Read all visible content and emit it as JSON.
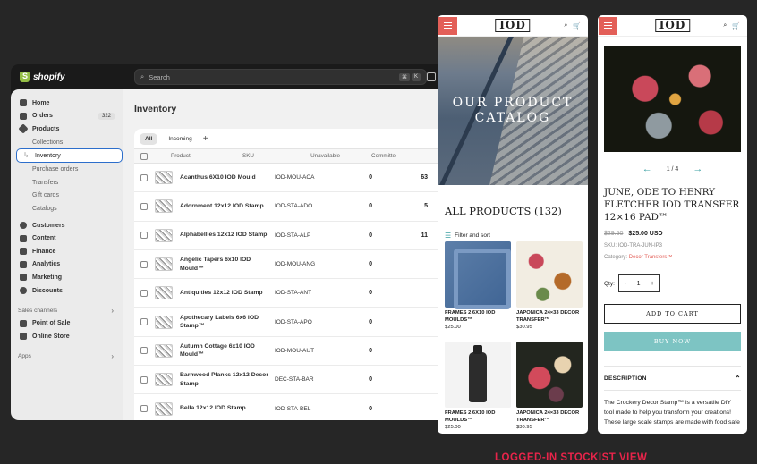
{
  "admin": {
    "logo_text": "shopify",
    "search_placeholder": "Search",
    "shortcut_keys": [
      "⌘",
      "K"
    ],
    "nav": [
      {
        "label": "Home",
        "icon": "home-icon"
      },
      {
        "label": "Orders",
        "icon": "orders-icon",
        "badge": "322"
      },
      {
        "label": "Products",
        "icon": "tag-icon"
      }
    ],
    "products_sub": [
      "Collections",
      "Inventory",
      "Purchase orders",
      "Transfers",
      "Gift cards",
      "Catalogs"
    ],
    "nav2": [
      {
        "label": "Customers",
        "icon": "person-icon"
      },
      {
        "label": "Content",
        "icon": "content-icon"
      },
      {
        "label": "Finance",
        "icon": "finance-icon"
      },
      {
        "label": "Analytics",
        "icon": "analytics-icon"
      },
      {
        "label": "Marketing",
        "icon": "marketing-icon"
      },
      {
        "label": "Discounts",
        "icon": "discount-icon"
      }
    ],
    "sales_channels_label": "Sales channels",
    "sales_channels": [
      {
        "label": "Point of Sale",
        "icon": "pos-icon"
      },
      {
        "label": "Online Store",
        "icon": "store-icon"
      }
    ],
    "apps_label": "Apps",
    "page_title": "Inventory",
    "tabs": [
      "All",
      "Incoming"
    ],
    "columns": {
      "product": "Product",
      "sku": "SKU",
      "unavailable": "Unavailable",
      "committed": "Committe"
    },
    "rows": [
      {
        "name": "Acanthus 6X10 IOD Mould",
        "sku": "IOD-MOU-ACA",
        "unavailable": "0",
        "committed": "63"
      },
      {
        "name": "Adornment 12x12 IOD Stamp",
        "sku": "IOD-STA-ADO",
        "unavailable": "0",
        "committed": "5"
      },
      {
        "name": "Alphabellies 12x12 IOD Stamp",
        "sku": "IOD-STA-ALP",
        "unavailable": "0",
        "committed": "11"
      },
      {
        "name": "Angelic Tapers 6x10 IOD Mould™",
        "sku": "IOD-MOU-ANG",
        "unavailable": "0",
        "committed": ""
      },
      {
        "name": "Antiquities 12x12 IOD Stamp",
        "sku": "IOD-STA-ANT",
        "unavailable": "0",
        "committed": ""
      },
      {
        "name": "Apothecary Labels 6x6 IOD Stamp™",
        "sku": "IOD-STA-APO",
        "unavailable": "0",
        "committed": ""
      },
      {
        "name": "Autumn Cottage 6x10 IOD Mould™",
        "sku": "IOD-MOU-AUT",
        "unavailable": "0",
        "committed": ""
      },
      {
        "name": "Barnwood Planks 12x12 Decor Stamp",
        "sku": "DEC-STA-BAR",
        "unavailable": "0",
        "committed": ""
      },
      {
        "name": "Bella 12x12 IOD Stamp",
        "sku": "IOD-STA-BEL",
        "unavailable": "0",
        "committed": ""
      }
    ]
  },
  "catalog": {
    "brand": "IOD",
    "hero_text_1": "OUR PRODUCT",
    "hero_text_2": "CATALOG",
    "all_products": "ALL PRODUCTS (132)",
    "filter_label": "Filter and sort",
    "items": [
      {
        "name": "FRAMES 2 6X10 IOD MOULDS™",
        "price": "$25.00",
        "img": "img-frames"
      },
      {
        "name": "JAPONICA 24×33 DECOR TRANSFER™",
        "price": "$30.95",
        "img": "img-japonica"
      },
      {
        "name": "FRAMES 2 6X10 IOD MOULDS™",
        "price": "$25.00",
        "img": "img-bottle"
      },
      {
        "name": "JAPONICA 24×33 DECOR TRANSFER™",
        "price": "$30.95",
        "img": "img-japonica2"
      }
    ]
  },
  "product": {
    "brand": "IOD",
    "pager": "1 / 4",
    "title": "JUNE, ODE TO HENRY FLETCHER IOD TRANSFER 12×16 PAD™",
    "price_was": "$29.50",
    "price_now": "$25.00 USD",
    "sku_label": "SKU: IOD-TRA-JUN-IP3",
    "category_label": "Category:",
    "category_value": "Decor Transfers™",
    "qty_label": "Qty:",
    "qty_minus": "-",
    "qty_value": "1",
    "qty_plus": "+",
    "add_to_cart": "ADD TO CART",
    "buy_now": "BUY NOW",
    "description_label": "DESCRIPTION",
    "description_text": "The Crockery Decor Stamp™ is a versatile DIY tool made to help you transform your creations! These large scale stamps are made with food safe"
  },
  "caption": "LOGGED-IN STOCKIST VIEW",
  "colors": {
    "accent": "#e35f58",
    "teal": "#7dc4c3",
    "caption": "#e8244a",
    "active_outline": "#2c6ecb"
  }
}
